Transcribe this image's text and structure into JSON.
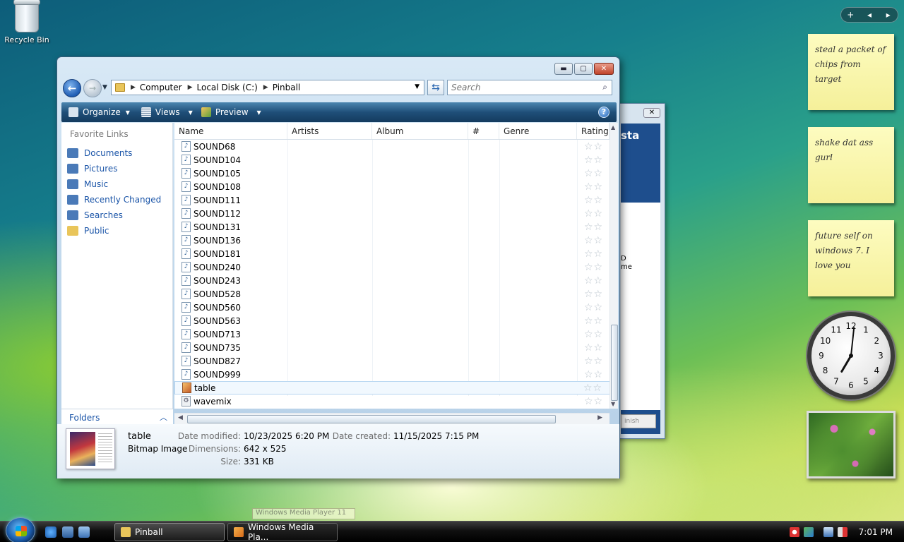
{
  "desktop": {
    "recycle_bin_label": "Recycle Bin",
    "sidebar_controls": [
      "+",
      "◂",
      "▸"
    ]
  },
  "sticky_notes": [
    {
      "text": "steal a packet of chips from target"
    },
    {
      "text": "shake dat ass gurl"
    },
    {
      "text": "future self on windows 7. I love you"
    }
  ],
  "clock_gadget": {
    "numerals": [
      "12",
      "1",
      "2",
      "3",
      "4",
      "5",
      "6",
      "7",
      "8",
      "9",
      "10",
      "11"
    ],
    "time": "7:01"
  },
  "background_window": {
    "banner_text": "sta",
    "body_text_1": "D",
    "body_text_2": "me",
    "finish_label": "inish",
    "close_label": "✕"
  },
  "explorer": {
    "caption_buttons": {
      "minimize": "▬",
      "maximize": "▢",
      "close": "✕"
    },
    "address": {
      "crumbs": [
        "Computer",
        "Local Disk (C:)",
        "Pinball"
      ]
    },
    "search": {
      "placeholder": "Search"
    },
    "toolbar": {
      "organize": "Organize",
      "views": "Views",
      "preview": "Preview",
      "help": "?"
    },
    "nav": {
      "header": "Favorite Links",
      "links": [
        {
          "label": "Documents",
          "icon": "documents-icon",
          "color": "#4a7ab8"
        },
        {
          "label": "Pictures",
          "icon": "pictures-icon",
          "color": "#4a7ab8"
        },
        {
          "label": "Music",
          "icon": "music-icon",
          "color": "#4a7ab8"
        },
        {
          "label": "Recently Changed",
          "icon": "recent-icon",
          "color": "#4a7ab8"
        },
        {
          "label": "Searches",
          "icon": "searches-icon",
          "color": "#4a7ab8"
        },
        {
          "label": "Public",
          "icon": "public-folder-icon",
          "color": "#e9c55a"
        }
      ],
      "folders_label": "Folders"
    },
    "columns": [
      "Name",
      "Artists",
      "Album",
      "#",
      "Genre",
      "Rating"
    ],
    "files": [
      {
        "name": "SOUND68",
        "type": "wav"
      },
      {
        "name": "SOUND104",
        "type": "wav"
      },
      {
        "name": "SOUND105",
        "type": "wav"
      },
      {
        "name": "SOUND108",
        "type": "wav"
      },
      {
        "name": "SOUND111",
        "type": "wav"
      },
      {
        "name": "SOUND112",
        "type": "wav"
      },
      {
        "name": "SOUND131",
        "type": "wav"
      },
      {
        "name": "SOUND136",
        "type": "wav"
      },
      {
        "name": "SOUND181",
        "type": "wav"
      },
      {
        "name": "SOUND240",
        "type": "wav"
      },
      {
        "name": "SOUND243",
        "type": "wav"
      },
      {
        "name": "SOUND528",
        "type": "wav"
      },
      {
        "name": "SOUND560",
        "type": "wav"
      },
      {
        "name": "SOUND563",
        "type": "wav"
      },
      {
        "name": "SOUND713",
        "type": "wav"
      },
      {
        "name": "SOUND735",
        "type": "wav"
      },
      {
        "name": "SOUND827",
        "type": "wav"
      },
      {
        "name": "SOUND999",
        "type": "wav"
      },
      {
        "name": "table",
        "type": "bmp",
        "selected": true
      },
      {
        "name": "wavemix",
        "type": "exe"
      }
    ],
    "details": {
      "name": "table",
      "type": "Bitmap Image",
      "date_modified_label": "Date modified:",
      "date_modified": "10/23/2025 6:20 PM",
      "dimensions_label": "Dimensions:",
      "dimensions": "642 x 525",
      "size_label": "Size:",
      "size": "331 KB",
      "date_created_label": "Date created:",
      "date_created": "11/15/2025 7:15 PM"
    }
  },
  "taskbar": {
    "tasks": [
      {
        "label": "Pinball",
        "active": true
      },
      {
        "label": "Windows Media Pla...",
        "active": false
      }
    ],
    "tooltip": "Windows Media Player 11",
    "clock": "7:01 PM"
  }
}
